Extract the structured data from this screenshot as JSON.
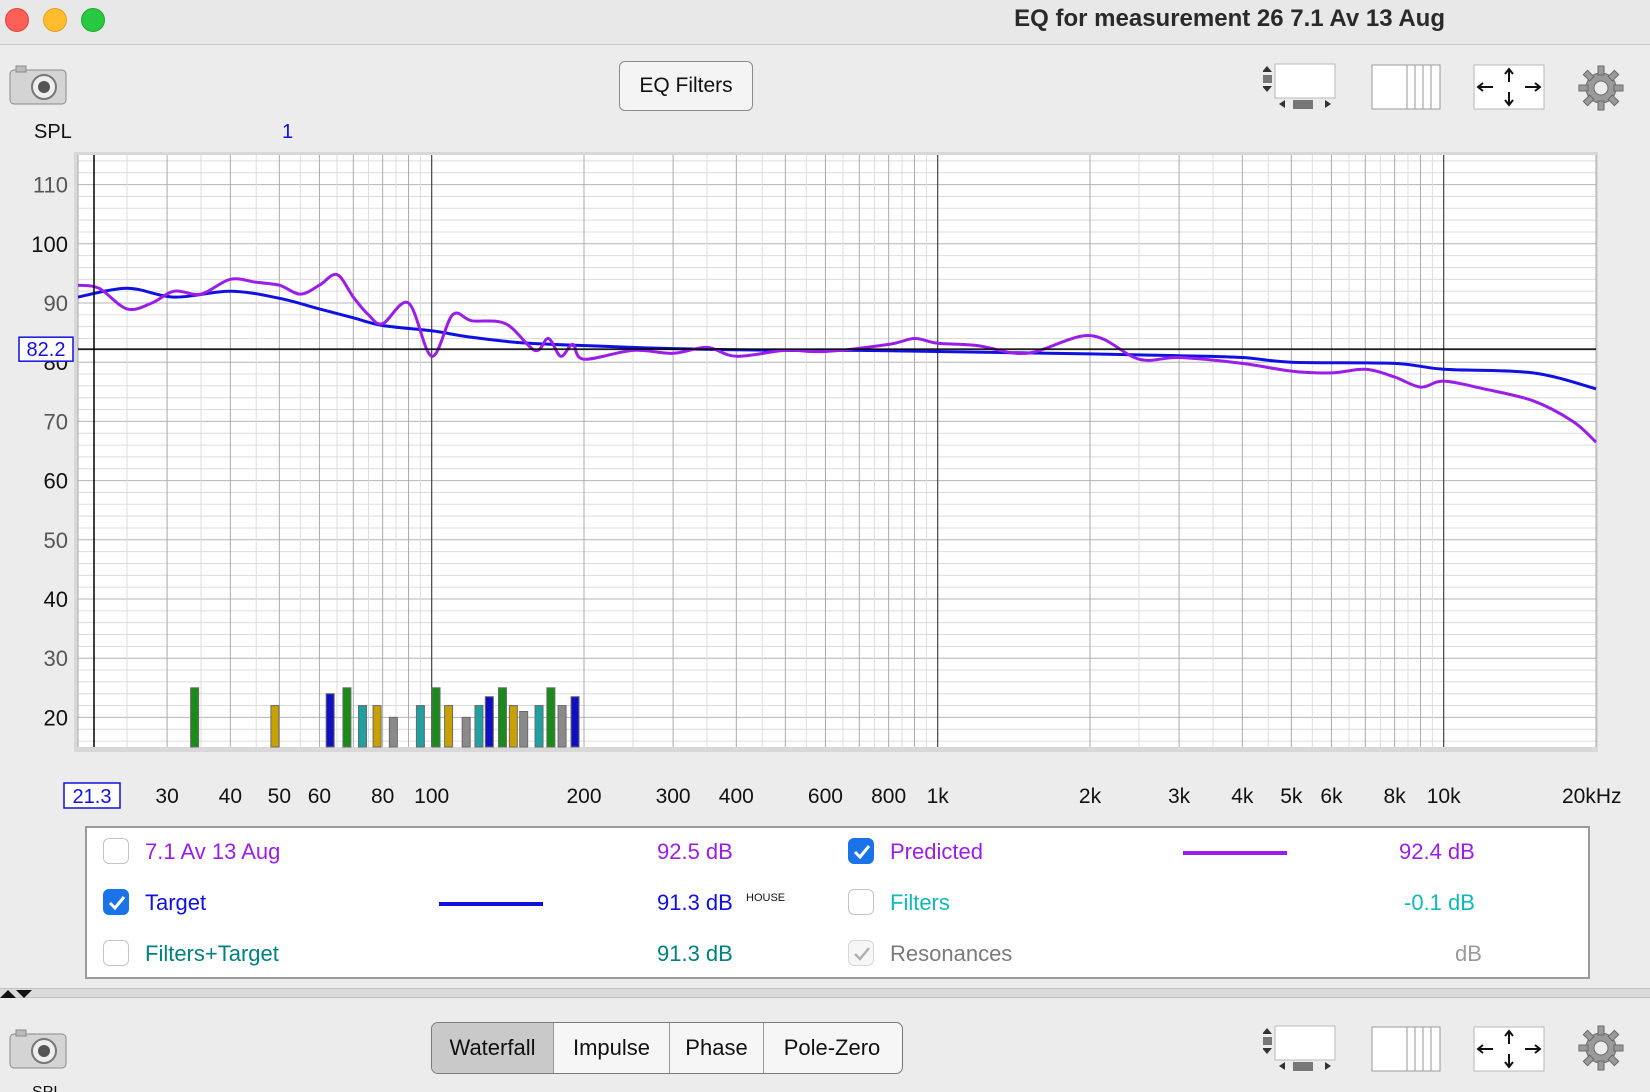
{
  "window": {
    "title": "EQ for measurement 26 7.1 Av 13 Aug"
  },
  "toolbar": {
    "eq_filters_label": "EQ Filters"
  },
  "plot": {
    "y_axis_name": "SPL",
    "marker_label": "1",
    "cursor_x_label": "21.3",
    "cursor_y_label": "82.2",
    "cursor_y_value": 82.2,
    "y_ticks": [
      "110",
      "100",
      "90",
      "80",
      "70",
      "60",
      "50",
      "40",
      "30",
      "20"
    ],
    "x_ticks": [
      "30",
      "40",
      "50",
      "60",
      "80",
      "100",
      "200",
      "300",
      "400",
      "600",
      "800",
      "1k",
      "2k",
      "3k",
      "4k",
      "5k",
      "6k",
      "8k",
      "10k",
      "20kHz"
    ]
  },
  "chart_data": {
    "type": "line",
    "x_scale": "log",
    "xlim": [
      20,
      20000
    ],
    "ylim": [
      15,
      115
    ],
    "ylabel": "SPL",
    "series": [
      {
        "name": "Target",
        "color": "#1010e0",
        "x": [
          20,
          25,
          31,
          40,
          50,
          60,
          70,
          80,
          100,
          120,
          150,
          200,
          300,
          500,
          700,
          1000,
          2000,
          3000,
          4000,
          5000,
          8000,
          10000,
          15000,
          20000
        ],
        "y": [
          91,
          92.5,
          91,
          92,
          90.8,
          89,
          87.5,
          86.2,
          85.3,
          84.2,
          83.3,
          82.8,
          82.3,
          82,
          82,
          81.8,
          81.4,
          81.1,
          80.8,
          80,
          79.8,
          78.8,
          78.2,
          75.5
        ]
      },
      {
        "name": "Predicted",
        "color": "#9a1ee8",
        "x": [
          20,
          22,
          25,
          28,
          31,
          35,
          40,
          45,
          50,
          55,
          60,
          65,
          70,
          75,
          80,
          90,
          100,
          110,
          120,
          140,
          160,
          170,
          180,
          190,
          200,
          250,
          300,
          350,
          400,
          500,
          600,
          800,
          900,
          1000,
          1200,
          1500,
          2000,
          2500,
          3000,
          4000,
          5000,
          6000,
          7000,
          8000,
          9000,
          10000,
          12000,
          15000,
          18000,
          20000
        ],
        "y": [
          93,
          92.5,
          89,
          90,
          92,
          91.5,
          94,
          93.5,
          93,
          91.5,
          93,
          94.8,
          91,
          88,
          86.5,
          90,
          81,
          88,
          87,
          86.5,
          82,
          84,
          81,
          83,
          80.5,
          82,
          81.5,
          82.5,
          81,
          82,
          81.8,
          83,
          84,
          83.2,
          82.8,
          81.5,
          84.5,
          80.5,
          80.8,
          79.8,
          78.5,
          78.2,
          78.8,
          77.5,
          75.8,
          76.8,
          75.5,
          73.5,
          70,
          66.5
        ]
      }
    ],
    "resonances": [
      {
        "f": 34,
        "color": "#1a8a1a",
        "level": 25
      },
      {
        "f": 49,
        "color": "#c8a000",
        "level": 22
      },
      {
        "f": 63,
        "color": "#1010c0",
        "level": 24
      },
      {
        "f": 68,
        "color": "#1a8a1a",
        "level": 25
      },
      {
        "f": 73,
        "color": "#20a0a0",
        "level": 22
      },
      {
        "f": 78,
        "color": "#c8a000",
        "level": 22
      },
      {
        "f": 84,
        "color": "#8a8a8a",
        "level": 20
      },
      {
        "f": 95,
        "color": "#20a0a0",
        "level": 22
      },
      {
        "f": 102,
        "color": "#1a8a1a",
        "level": 25
      },
      {
        "f": 108,
        "color": "#c8a000",
        "level": 22
      },
      {
        "f": 117,
        "color": "#8a8a8a",
        "level": 20
      },
      {
        "f": 124,
        "color": "#20a0a0",
        "level": 22
      },
      {
        "f": 130,
        "color": "#1010c0",
        "level": 23.5
      },
      {
        "f": 138,
        "color": "#1a8a1a",
        "level": 25
      },
      {
        "f": 145,
        "color": "#c8a000",
        "level": 22
      },
      {
        "f": 152,
        "color": "#8a8a8a",
        "level": 21
      },
      {
        "f": 163,
        "color": "#20a0a0",
        "level": 22
      },
      {
        "f": 172,
        "color": "#1a8a1a",
        "level": 25
      },
      {
        "f": 181,
        "color": "#8a8a8a",
        "level": 22
      },
      {
        "f": 192,
        "color": "#1010c0",
        "level": 23.5
      }
    ]
  },
  "legend": {
    "items": [
      {
        "label": "7.1 Av 13 Aug",
        "value": "92.5 dB",
        "checked": false,
        "color": "#9a1ee8"
      },
      {
        "label": "Target",
        "value": "91.3 dB",
        "suffix": "HOUSE",
        "checked": true,
        "color": "#1010e0"
      },
      {
        "label": "Filters+Target",
        "value": "91.3 dB",
        "checked": false,
        "color": "#008080"
      },
      {
        "label": "Predicted",
        "value": "92.4 dB",
        "checked": true,
        "color": "#9a1ee8"
      },
      {
        "label": "Filters",
        "value": "-0.1 dB",
        "checked": false,
        "color": "#10b8b8"
      },
      {
        "label": "Resonances",
        "value": "dB",
        "checked": "disabled",
        "color": "#7a7a7a"
      }
    ]
  },
  "bottom_tabs": {
    "items": [
      "Waterfall",
      "Impulse",
      "Phase",
      "Pole-Zero"
    ],
    "active": "Waterfall"
  },
  "bottom_panel": {
    "y_axis_name_partial": "SPL"
  }
}
